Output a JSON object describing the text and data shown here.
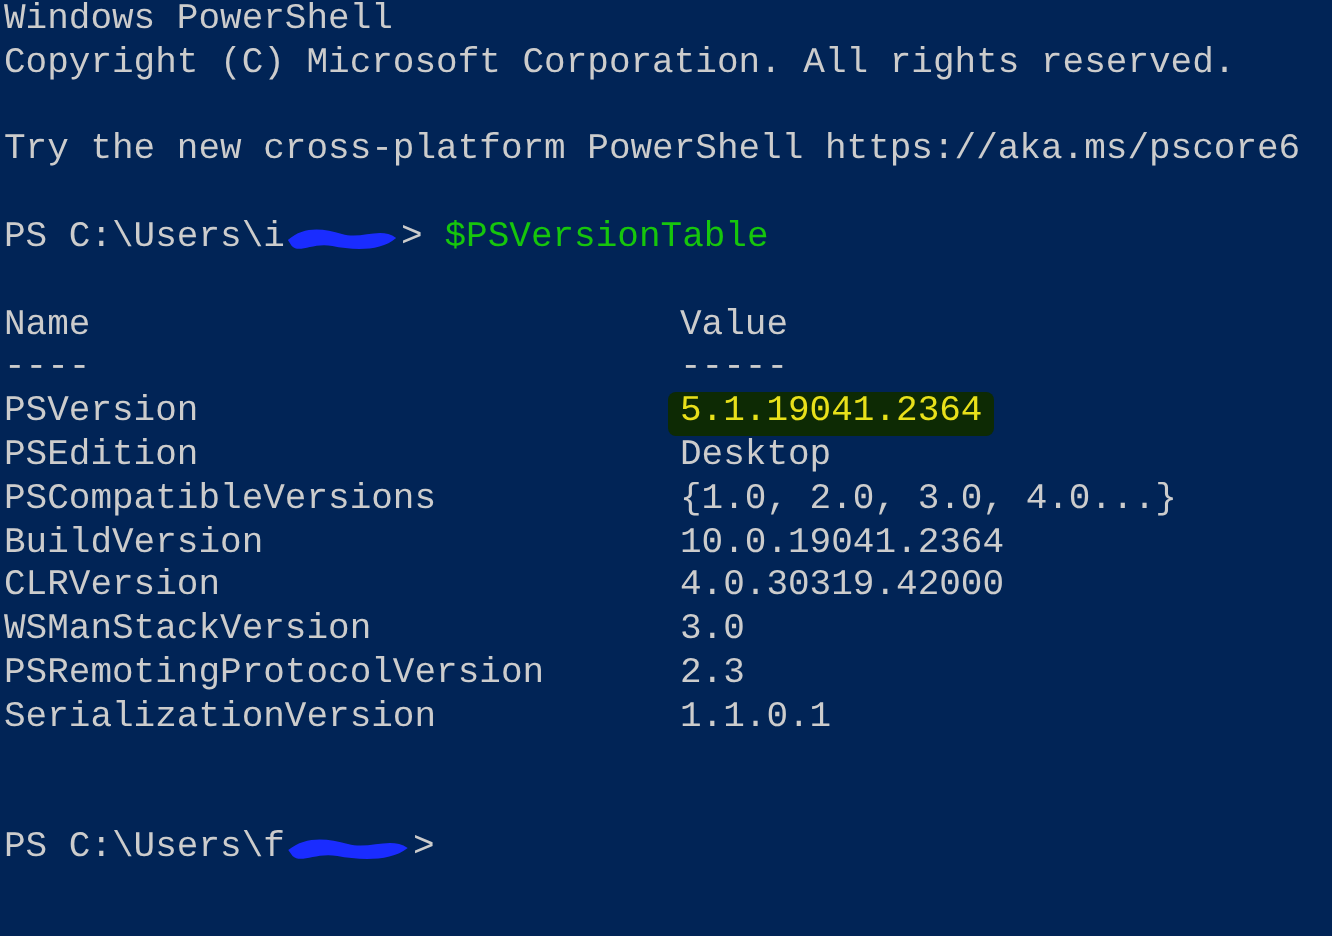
{
  "banner": [
    "Windows PowerShell",
    "Copyright (C) Microsoft Corporation. All rights reserved."
  ],
  "hint": "Try the new cross-platform PowerShell https://aka.ms/pscore6",
  "prompt_1": {
    "prefix": "PS C:\\Users\\i",
    "suffix": ">",
    "command": "$PSVersionTable"
  },
  "table": {
    "columns": [
      {
        "name": "Name",
        "rule": "----"
      },
      {
        "name": "Value",
        "rule": "-----"
      }
    ],
    "rows": [
      {
        "name": "PSVersion",
        "value": "5.1.19041.2364",
        "highlighted": true
      },
      {
        "name": "PSEdition",
        "value": "Desktop",
        "highlighted": false
      },
      {
        "name": "PSCompatibleVersions",
        "value": "{1.0, 2.0, 3.0, 4.0...}",
        "highlighted": false
      },
      {
        "name": "BuildVersion",
        "value": "10.0.19041.2364",
        "highlighted": false
      },
      {
        "name": "CLRVersion",
        "value": "4.0.30319.42000",
        "highlighted": false
      },
      {
        "name": "WSManStackVersion",
        "value": "3.0",
        "highlighted": false
      },
      {
        "name": "PSRemotingProtocolVersion",
        "value": "2.3",
        "highlighted": false
      },
      {
        "name": "SerializationVersion",
        "value": "1.1.0.1",
        "highlighted": false
      }
    ]
  },
  "prompt_2": {
    "prefix": "PS C:\\Users\\f",
    "suffix": ">"
  }
}
